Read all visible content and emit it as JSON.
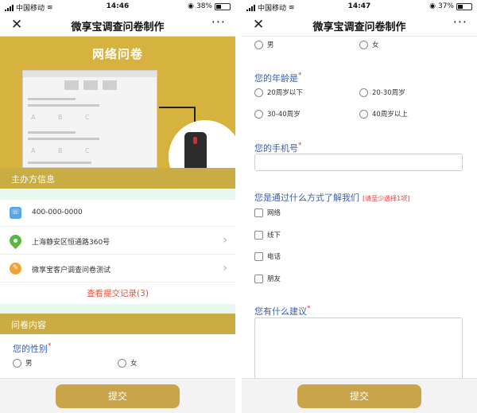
{
  "left": {
    "status": {
      "carrier": "中国移动",
      "time": "14:46",
      "battery": "38%",
      "battery_level": 0.38
    },
    "nav": {
      "title": "微享宝调查问卷制作",
      "close": "✕",
      "more": "···"
    },
    "banner": {
      "title": "网络问卷",
      "options": [
        "A",
        "B",
        "C"
      ]
    },
    "organizer": {
      "heading": "主办方信息",
      "phone": "400-000-0000",
      "address": "上海静安区恒通路360号",
      "survey_name": "微享宝客户调查问卷测试",
      "records_link": "查看提交记录(3)"
    },
    "content": {
      "heading": "问卷内容",
      "gender_question": "您的性别",
      "gender_options": [
        "男",
        "女"
      ]
    },
    "submit": "提交"
  },
  "right": {
    "status": {
      "carrier": "中国移动",
      "time": "14:47",
      "battery": "37%",
      "battery_level": 0.37
    },
    "nav": {
      "title": "微享宝调查问卷制作",
      "close": "✕",
      "more": "···"
    },
    "gender_options": [
      "男",
      "女"
    ],
    "age_question": "您的年龄是",
    "age_options": [
      "20周岁以下",
      "20-30周岁",
      "30-40周岁",
      "40周岁以上"
    ],
    "phone_question": "您的手机号",
    "source_question": "您是通过什么方式了解我们",
    "source_hint": "[请至少选择1项]",
    "source_options": [
      "网络",
      "线下",
      "电话",
      "朋友"
    ],
    "suggestion_question": "您有什么建议",
    "required_mark": "*",
    "submit": "提交"
  },
  "colors": {
    "banner": "#d5b33e",
    "section_header": "#c9ac43",
    "submit_button": "#c9a44a",
    "question_text": "#3a5fae",
    "link_red": "#e5533a",
    "section_gap": "#e7f8ee"
  },
  "icons": [
    "phone-icon",
    "location-pin-icon",
    "pencil-icon",
    "chevron-right-icon",
    "wifi-icon",
    "battery-icon",
    "close-icon",
    "more-icon"
  ]
}
